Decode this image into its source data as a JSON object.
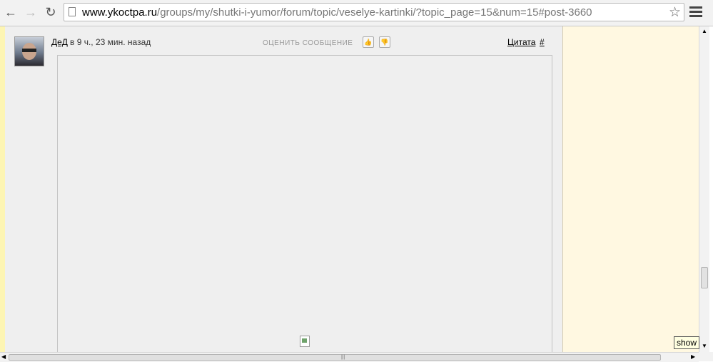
{
  "toolbar": {
    "back_icon": "←",
    "forward_icon": "→",
    "reload_icon": "↻",
    "url_host": "www.ykoctpa.ru",
    "url_path": "/groups/my/shutki-i-yumor/forum/topic/veselye-kartinki/?topic_page=15&num=15#post-3660",
    "star_icon": "☆"
  },
  "post": {
    "author": "ДеД",
    "time": "в 9 ч., 23 мин. назад",
    "rate_label": "ОЦЕНИТЬ СООБЩЕНИЕ",
    "like_icon": "👍",
    "dislike_icon": "👎",
    "quote_label": "Цитата",
    "hash_label": "#"
  },
  "scrollbars": {
    "up": "▲",
    "down": "▼",
    "left": "◀",
    "right": "▶",
    "grip": "|||"
  },
  "tooltip": {
    "label": "show"
  }
}
